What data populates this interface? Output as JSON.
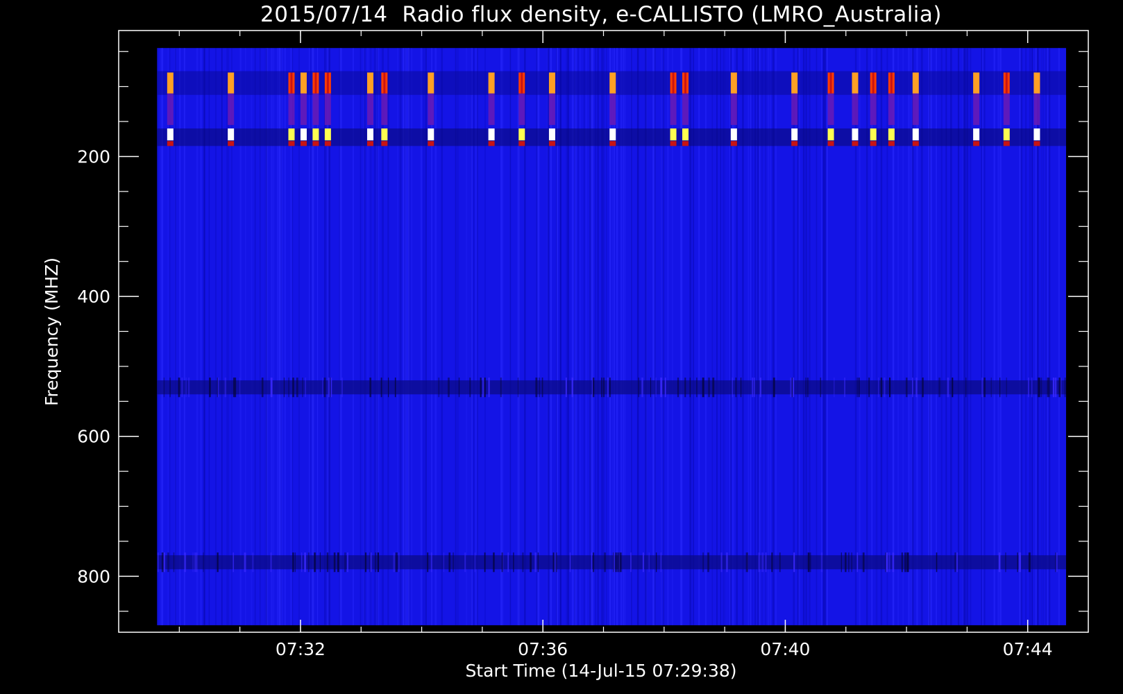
{
  "chart_data": {
    "type": "heatmap",
    "title": "2015/07/14  Radio flux density, e-CALLISTO (LMRO_Australia)",
    "xlabel": "Start Time (14-Jul-15 07:29:38)",
    "ylabel": "Frequency (MHZ)",
    "x_unit": "time (HH:MM)",
    "xlim": [
      "07:29:00",
      "07:45:00"
    ],
    "ylim": [
      880,
      20
    ],
    "y_inverted": true,
    "x_ticks": [
      "07:32",
      "07:36",
      "07:40",
      "07:44"
    ],
    "y_ticks": [
      200,
      400,
      600,
      800
    ],
    "data_extent": {
      "time_start": "07:29:38",
      "time_end": "07:44:38",
      "freq_min": 45,
      "freq_max": 870
    },
    "background_color": "#1414e6",
    "colormap": [
      "#000030",
      "#1414e6",
      "#6a1ab4",
      "#c81414",
      "#ff3c00",
      "#ffa024",
      "#ffff50",
      "#ffffff"
    ],
    "bursts": [
      {
        "time": "07:29:48",
        "intensity": "orange"
      },
      {
        "time": "07:30:48",
        "intensity": "orange"
      },
      {
        "time": "07:31:48",
        "intensity": "red"
      },
      {
        "time": "07:32:00",
        "intensity": "orange"
      },
      {
        "time": "07:32:12",
        "intensity": "red"
      },
      {
        "time": "07:32:24",
        "intensity": "red"
      },
      {
        "time": "07:33:06",
        "intensity": "orange"
      },
      {
        "time": "07:33:20",
        "intensity": "red"
      },
      {
        "time": "07:34:06",
        "intensity": "orange"
      },
      {
        "time": "07:35:06",
        "intensity": "orange"
      },
      {
        "time": "07:35:36",
        "intensity": "red"
      },
      {
        "time": "07:36:06",
        "intensity": "orange"
      },
      {
        "time": "07:37:06",
        "intensity": "orange"
      },
      {
        "time": "07:38:06",
        "intensity": "red"
      },
      {
        "time": "07:38:18",
        "intensity": "red"
      },
      {
        "time": "07:39:06",
        "intensity": "orange"
      },
      {
        "time": "07:40:06",
        "intensity": "orange"
      },
      {
        "time": "07:40:42",
        "intensity": "red"
      },
      {
        "time": "07:41:06",
        "intensity": "orange"
      },
      {
        "time": "07:41:24",
        "intensity": "red"
      },
      {
        "time": "07:41:42",
        "intensity": "red"
      },
      {
        "time": "07:42:06",
        "intensity": "orange"
      },
      {
        "time": "07:43:06",
        "intensity": "orange"
      },
      {
        "time": "07:43:36",
        "intensity": "red"
      },
      {
        "time": "07:44:06",
        "intensity": "orange"
      }
    ],
    "dark_bands_mhz": [
      [
        520,
        540
      ],
      [
        770,
        790
      ]
    ],
    "burst_freq_ranges_mhz": [
      [
        80,
        110
      ],
      [
        160,
        175
      ],
      [
        178,
        185
      ]
    ],
    "grid": false,
    "legend": "none"
  }
}
